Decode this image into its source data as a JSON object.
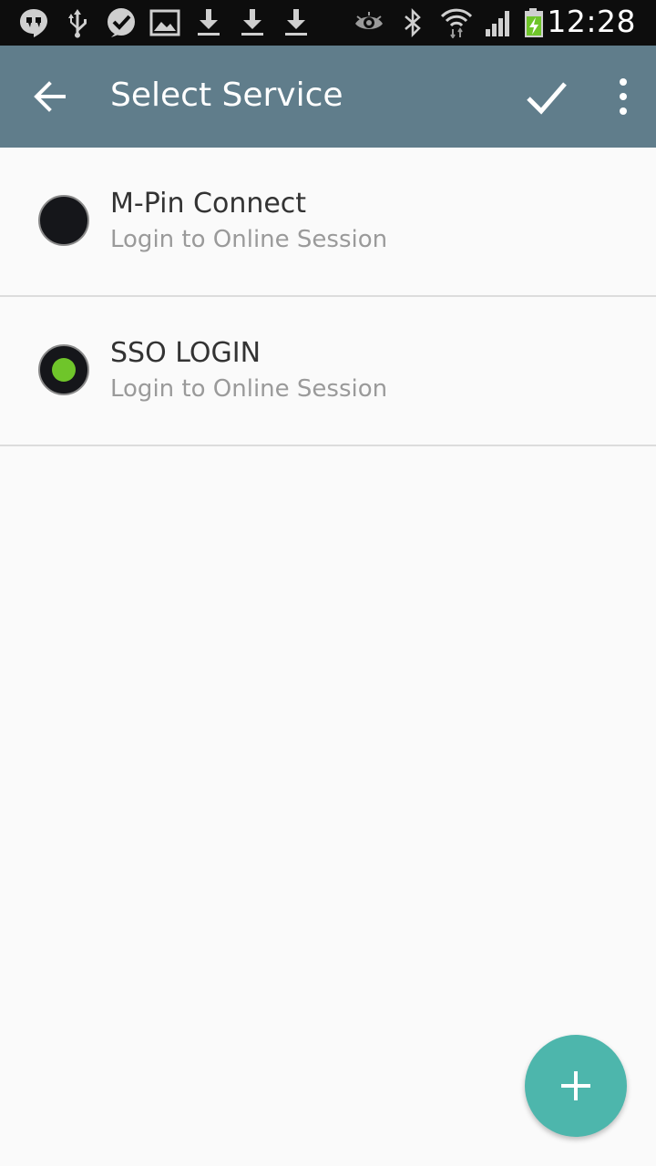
{
  "status_bar": {
    "time": "12:28",
    "icons": [
      "hangouts-icon",
      "usb-icon",
      "check-message-icon",
      "gallery-icon",
      "download-icon",
      "download-icon",
      "download-icon",
      "eye-icon",
      "bluetooth-icon",
      "wifi-icon",
      "signal-icon",
      "battery-charging-icon"
    ]
  },
  "app_bar": {
    "title": "Select Service",
    "color": "#607d8b"
  },
  "services": [
    {
      "title": "M-Pin Connect",
      "subtitle": "Login to Online Session",
      "selected": false
    },
    {
      "title": "SSO LOGIN",
      "subtitle": "Login to Online Session",
      "selected": true
    }
  ],
  "colors": {
    "accent": "#4db6ac",
    "selected_dot": "#6fc52a"
  }
}
